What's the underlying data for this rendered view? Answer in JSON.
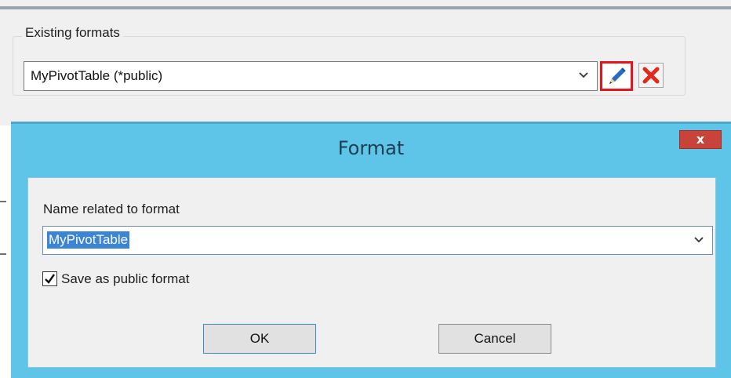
{
  "background_window": {
    "group_title": "Existing formats",
    "formats_dropdown": {
      "selected_value": "MyPivotTable (*public)",
      "icon": "chevron-down-icon"
    },
    "edit_button_icon": "pencil-icon",
    "delete_button_icon": "red-x-icon"
  },
  "dialog": {
    "title": "Format",
    "close_label": "x",
    "name_label": "Name related to format",
    "name_value": "MyPivotTable",
    "public_checkbox": {
      "label": "Save as public format",
      "checked": true
    },
    "ok_label": "OK",
    "cancel_label": "Cancel"
  },
  "colors": {
    "dialog_frame": "#5ec4e8",
    "close_button": "#c8433a",
    "highlight_border": "#e8141d",
    "selection": "#3c84d6"
  }
}
